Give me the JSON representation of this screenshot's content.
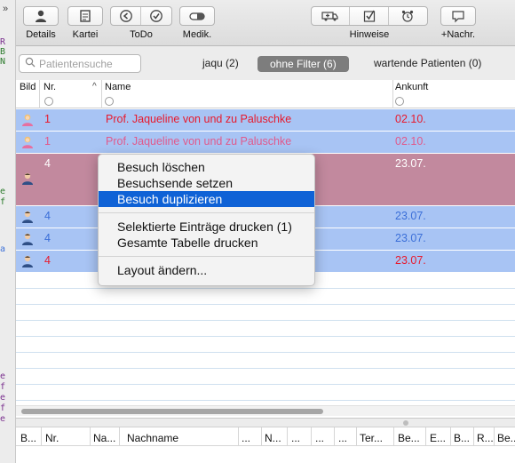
{
  "toolbar": {
    "details": "Details",
    "kartei": "Kartei",
    "todo": "ToDo",
    "medik": "Medik.",
    "hinweise": "Hinweise",
    "nachr": "+Nachr."
  },
  "search": {
    "placeholder": "Patientensuche"
  },
  "filters": [
    {
      "label": "jaqu (2)"
    },
    {
      "label": "ohne Filter (6)"
    },
    {
      "label": "wartende Patienten (0)"
    }
  ],
  "columns": {
    "bild": "Bild",
    "nr": "Nr.",
    "name": "Name",
    "ankunft": "Ankunft"
  },
  "rows": [
    {
      "nr": "1",
      "name": "Prof. Jaqueline von und zu Paluschke",
      "ankunft": "02.10."
    },
    {
      "nr": "1",
      "name": "Prof. Jaqueline von und zu Paluschke",
      "ankunft": "02.10."
    },
    {
      "nr": "4",
      "name": "",
      "ankunft": "23.07."
    },
    {
      "nr": "4",
      "name": "",
      "ankunft": "23.07."
    },
    {
      "nr": "4",
      "name": "",
      "ankunft": "23.07."
    },
    {
      "nr": "4",
      "name": "",
      "ankunft": "23.07."
    }
  ],
  "context_menu": {
    "items": [
      "Besuch löschen",
      "Besuchsende setzen",
      "Besuch duplizieren",
      "Selektierte Einträge drucken (1)",
      "Gesamte Tabelle drucken",
      "Layout ändern..."
    ]
  },
  "bottom_columns": [
    "B...",
    "Nr.",
    "Na...",
    "Nachname",
    "...",
    "N...",
    "...",
    "...",
    "...",
    "Ter...",
    "Be...",
    "E...",
    "B...",
    "R...",
    "Be..."
  ],
  "left_fragments": [
    "R",
    "B",
    "N",
    "e",
    "f",
    "a",
    "e",
    "f",
    "e",
    "f",
    "e"
  ],
  "colors": {
    "row_blue": "#a8c4f4",
    "row_mauve": "#c2899e",
    "text_red": "#e8192c",
    "text_pink": "#e05a8c",
    "text_blue": "#3b6fd8",
    "menu_highlight": "#0f62d6"
  },
  "icons": [
    "person-icon",
    "card-file-icon",
    "back-arrow-icon",
    "checkmark-icon",
    "pill-icon",
    "ambulance-icon",
    "checkbox-icon",
    "alarm-clock-icon",
    "speech-bubble-icon",
    "magnifier-icon",
    "female-avatar-icon",
    "male-avatar-icon"
  ]
}
